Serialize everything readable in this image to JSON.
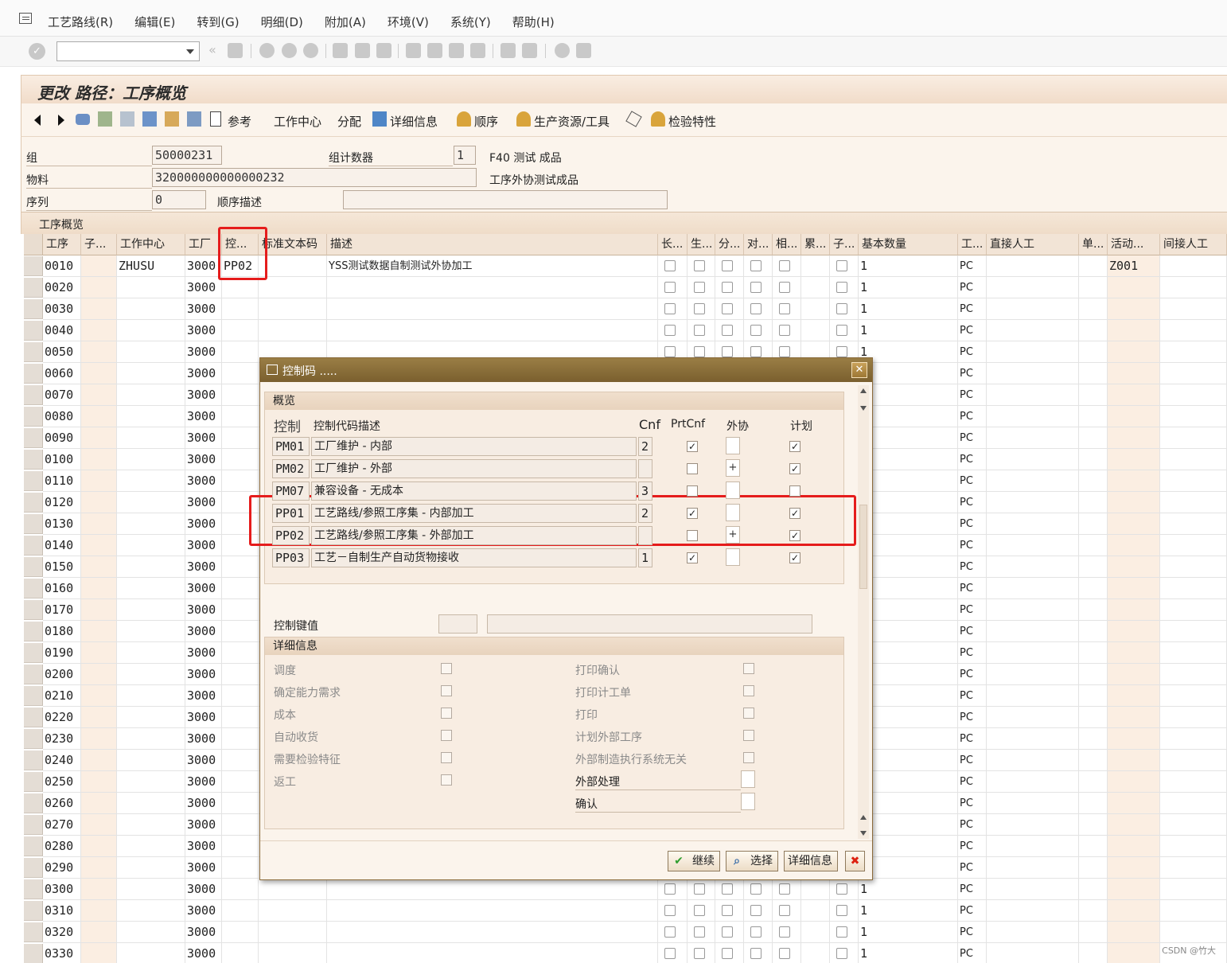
{
  "menu": [
    "工艺路线(R)",
    "编辑(E)",
    "转到(G)",
    "明细(D)",
    "附加(A)",
    "环境(V)",
    "系统(Y)",
    "帮助(H)"
  ],
  "screen_title": "更改 路径：工序概览",
  "app_toolbar": {
    "reference": "参考",
    "work_center": "工作中心",
    "assign": "分配",
    "detail": "详细信息",
    "sequence": "顺序",
    "prt": "生产资源/工具",
    "inspection": "检验特性"
  },
  "header": {
    "group_label": "组",
    "group": "50000231",
    "counter_label": "组计数器",
    "counter": "1",
    "counter_desc": "F40 测试 成品",
    "material_label": "物料",
    "material": "320000000000000232",
    "material_desc": "工序外协测试成品",
    "seq_label": "序列",
    "seq": "0",
    "seq_desc_label": "顺序描述",
    "seq_desc": ""
  },
  "section_title": "工序概览",
  "table": {
    "columns": [
      "工序",
      "子...",
      "工作中心",
      "工厂",
      "控...",
      "标准文本码",
      "描述",
      "长...",
      "生...",
      "分...",
      "对...",
      "相...",
      "累...",
      "子...",
      "基本数量",
      "工...",
      "直接人工",
      "单...",
      "活动...",
      "间接人工"
    ],
    "rows": [
      {
        "op": "0010",
        "wc": "ZHUSU",
        "plant": "3000",
        "ctrl": "PP02",
        "desc": "YSS测试数据自制测试外协加工",
        "qty": "1",
        "unit": "PC",
        "act": "Z001"
      },
      {
        "op": "0020",
        "wc": "",
        "plant": "3000",
        "ctrl": "",
        "desc": "",
        "qty": "1",
        "unit": "PC",
        "act": ""
      },
      {
        "op": "0030",
        "wc": "",
        "plant": "3000",
        "ctrl": "",
        "desc": "",
        "qty": "1",
        "unit": "PC",
        "act": ""
      },
      {
        "op": "0040",
        "wc": "",
        "plant": "3000",
        "ctrl": "",
        "desc": "",
        "qty": "1",
        "unit": "PC",
        "act": ""
      },
      {
        "op": "0050",
        "wc": "",
        "plant": "3000",
        "ctrl": "",
        "desc": "",
        "qty": "1",
        "unit": "PC",
        "act": ""
      },
      {
        "op": "0060",
        "wc": "",
        "plant": "3000",
        "ctrl": "",
        "desc": "",
        "qty": "",
        "unit": "PC",
        "act": ""
      },
      {
        "op": "0070",
        "wc": "",
        "plant": "3000",
        "ctrl": "",
        "desc": "",
        "qty": "",
        "unit": "PC",
        "act": ""
      },
      {
        "op": "0080",
        "wc": "",
        "plant": "3000",
        "ctrl": "",
        "desc": "",
        "qty": "",
        "unit": "PC",
        "act": ""
      },
      {
        "op": "0090",
        "wc": "",
        "plant": "3000",
        "ctrl": "",
        "desc": "",
        "qty": "",
        "unit": "PC",
        "act": ""
      },
      {
        "op": "0100",
        "wc": "",
        "plant": "3000",
        "ctrl": "",
        "desc": "",
        "qty": "",
        "unit": "PC",
        "act": ""
      },
      {
        "op": "0110",
        "wc": "",
        "plant": "3000",
        "ctrl": "",
        "desc": "",
        "qty": "",
        "unit": "PC",
        "act": ""
      },
      {
        "op": "0120",
        "wc": "",
        "plant": "3000",
        "ctrl": "",
        "desc": "",
        "qty": "",
        "unit": "PC",
        "act": ""
      },
      {
        "op": "0130",
        "wc": "",
        "plant": "3000",
        "ctrl": "",
        "desc": "",
        "qty": "",
        "unit": "PC",
        "act": ""
      },
      {
        "op": "0140",
        "wc": "",
        "plant": "3000",
        "ctrl": "",
        "desc": "",
        "qty": "",
        "unit": "PC",
        "act": ""
      },
      {
        "op": "0150",
        "wc": "",
        "plant": "3000",
        "ctrl": "",
        "desc": "",
        "qty": "",
        "unit": "PC",
        "act": ""
      },
      {
        "op": "0160",
        "wc": "",
        "plant": "3000",
        "ctrl": "",
        "desc": "",
        "qty": "",
        "unit": "PC",
        "act": ""
      },
      {
        "op": "0170",
        "wc": "",
        "plant": "3000",
        "ctrl": "",
        "desc": "",
        "qty": "",
        "unit": "PC",
        "act": ""
      },
      {
        "op": "0180",
        "wc": "",
        "plant": "3000",
        "ctrl": "",
        "desc": "",
        "qty": "",
        "unit": "PC",
        "act": ""
      },
      {
        "op": "0190",
        "wc": "",
        "plant": "3000",
        "ctrl": "",
        "desc": "",
        "qty": "",
        "unit": "PC",
        "act": ""
      },
      {
        "op": "0200",
        "wc": "",
        "plant": "3000",
        "ctrl": "",
        "desc": "",
        "qty": "",
        "unit": "PC",
        "act": ""
      },
      {
        "op": "0210",
        "wc": "",
        "plant": "3000",
        "ctrl": "",
        "desc": "",
        "qty": "",
        "unit": "PC",
        "act": ""
      },
      {
        "op": "0220",
        "wc": "",
        "plant": "3000",
        "ctrl": "",
        "desc": "",
        "qty": "",
        "unit": "PC",
        "act": ""
      },
      {
        "op": "0230",
        "wc": "",
        "plant": "3000",
        "ctrl": "",
        "desc": "",
        "qty": "",
        "unit": "PC",
        "act": ""
      },
      {
        "op": "0240",
        "wc": "",
        "plant": "3000",
        "ctrl": "",
        "desc": "",
        "qty": "",
        "unit": "PC",
        "act": ""
      },
      {
        "op": "0250",
        "wc": "",
        "plant": "3000",
        "ctrl": "",
        "desc": "",
        "qty": "",
        "unit": "PC",
        "act": ""
      },
      {
        "op": "0260",
        "wc": "",
        "plant": "3000",
        "ctrl": "",
        "desc": "",
        "qty": "",
        "unit": "PC",
        "act": ""
      },
      {
        "op": "0270",
        "wc": "",
        "plant": "3000",
        "ctrl": "",
        "desc": "",
        "qty": "",
        "unit": "PC",
        "act": ""
      },
      {
        "op": "0280",
        "wc": "",
        "plant": "3000",
        "ctrl": "",
        "desc": "",
        "qty": "",
        "unit": "PC",
        "act": ""
      },
      {
        "op": "0290",
        "wc": "",
        "plant": "3000",
        "ctrl": "",
        "desc": "",
        "qty": "",
        "unit": "PC",
        "act": ""
      },
      {
        "op": "0300",
        "wc": "",
        "plant": "3000",
        "ctrl": "",
        "desc": "",
        "qty": "1",
        "unit": "PC",
        "act": ""
      },
      {
        "op": "0310",
        "wc": "",
        "plant": "3000",
        "ctrl": "",
        "desc": "",
        "qty": "1",
        "unit": "PC",
        "act": ""
      },
      {
        "op": "0320",
        "wc": "",
        "plant": "3000",
        "ctrl": "",
        "desc": "",
        "qty": "1",
        "unit": "PC",
        "act": ""
      },
      {
        "op": "0330",
        "wc": "",
        "plant": "3000",
        "ctrl": "",
        "desc": "",
        "qty": "1",
        "unit": "PC",
        "act": ""
      }
    ]
  },
  "dialog": {
    "title": "控制码 .....",
    "overview_title": "概览",
    "col_ctrl": "控制",
    "col_desc": "控制代码描述",
    "col_cnf": "Cnf",
    "col_prtcnf": "PrtCnf",
    "col_ext": "外协",
    "col_plan": "计划",
    "rows": [
      {
        "code": "PM01",
        "desc": "工厂维护 - 内部",
        "cnf": "2",
        "prtcnf": "✓",
        "ext": "",
        "plan": "✓"
      },
      {
        "code": "PM02",
        "desc": "工厂维护 - 外部",
        "cnf": "",
        "prtcnf": "",
        "ext": "+",
        "plan": "✓"
      },
      {
        "code": "PM07",
        "desc": "兼容设备 - 无成本",
        "cnf": "3",
        "prtcnf": "",
        "ext": "",
        "plan": ""
      },
      {
        "code": "PP01",
        "desc": "工艺路线/参照工序集 - 内部加工",
        "cnf": "2",
        "prtcnf": "✓",
        "ext": "",
        "plan": "✓"
      },
      {
        "code": "PP02",
        "desc": "工艺路线/参照工序集 - 外部加工",
        "cnf": "",
        "prtcnf": "",
        "ext": "+",
        "plan": "✓"
      },
      {
        "code": "PP03",
        "desc": "工艺－自制生产自动货物接收",
        "cnf": "1",
        "prtcnf": "✓",
        "ext": "",
        "plan": "✓"
      }
    ],
    "key_label": "控制键值",
    "detail_title": "详细信息",
    "detail_left": [
      "调度",
      "确定能力需求",
      "成本",
      "自动收货",
      "需要检验特征",
      "返工"
    ],
    "detail_right": [
      "打印确认",
      "打印计工单",
      "打印",
      "计划外部工序",
      "外部制造执行系统无关"
    ],
    "ext_proc_label": "外部处理",
    "confirm_label": "确认",
    "btn_continue": "继续",
    "btn_select": "选择",
    "btn_detail": "详细信息"
  },
  "watermark": "CSDN @竹大"
}
